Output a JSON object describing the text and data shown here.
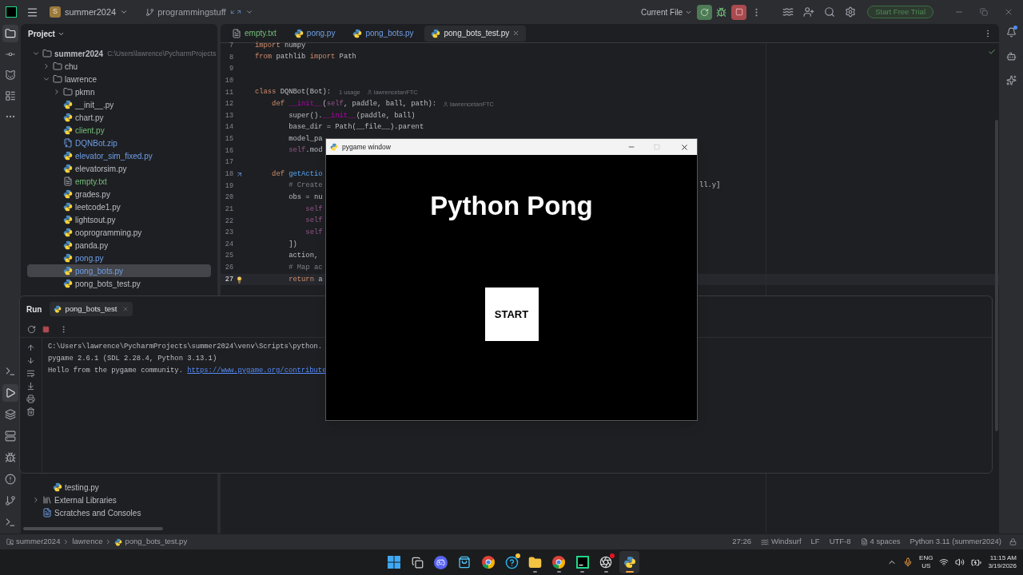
{
  "title_bar": {
    "project": {
      "badge": "S",
      "name": "summer2024"
    },
    "branch": "programmingstuff",
    "run_config": "Current File",
    "trial_button": "Start Free Trial"
  },
  "left_toolbar": {
    "top": [
      {
        "kind": "project",
        "selected": true
      },
      {
        "kind": "commit",
        "selected": false
      },
      {
        "kind": "pull_requests",
        "selected": false
      },
      {
        "kind": "structure",
        "selected": false
      },
      {
        "kind": "more",
        "selected": false
      }
    ],
    "bottom": [
      {
        "kind": "python_console",
        "selected": false
      },
      {
        "kind": "run",
        "selected": true
      },
      {
        "kind": "python_packages",
        "selected": false
      },
      {
        "kind": "services",
        "selected": false
      },
      {
        "kind": "debug",
        "selected": false
      },
      {
        "kind": "problems",
        "selected": false
      },
      {
        "kind": "git",
        "selected": false
      },
      {
        "kind": "terminal",
        "selected": false
      }
    ]
  },
  "right_toolbar": [
    {
      "kind": "notifications",
      "badge": true
    },
    {
      "kind": "ai_chat",
      "badge": false
    },
    {
      "kind": "windsurf",
      "badge": false
    }
  ],
  "project_panel": {
    "title": "Project",
    "tree": [
      {
        "label": "summer2024",
        "path": "C:\\Users\\lawrence\\PycharmProjects",
        "kind": "module",
        "added": false,
        "modified": false,
        "expanded": true,
        "selected": false,
        "children": [
          {
            "label": "chu",
            "kind": "folder",
            "added": false,
            "modified": false,
            "expanded": false,
            "selected": false
          },
          {
            "label": "lawrence",
            "kind": "folder",
            "added": false,
            "modified": false,
            "expanded": true,
            "selected": false,
            "children": [
              {
                "label": "pkmn",
                "kind": "plain_folder",
                "added": false,
                "modified": false,
                "expanded": false,
                "selected": false
              },
              {
                "label": "__init__.py",
                "kind": "python",
                "added": false,
                "modified": false,
                "selected": false
              },
              {
                "label": "chart.py",
                "kind": "python",
                "added": false,
                "modified": false,
                "selected": false
              },
              {
                "label": "client.py",
                "kind": "python",
                "added": true,
                "modified": false,
                "selected": false
              },
              {
                "label": "DQNBot.zip",
                "kind": "zip",
                "added": false,
                "modified": true,
                "selected": false
              },
              {
                "label": "elevator_sim_fixed.py",
                "kind": "python",
                "added": false,
                "modified": true,
                "selected": false
              },
              {
                "label": "elevatorsim.py",
                "kind": "python",
                "added": false,
                "modified": false,
                "selected": false
              },
              {
                "label": "empty.txt",
                "kind": "text",
                "added": true,
                "modified": false,
                "selected": false
              },
              {
                "label": "grades.py",
                "kind": "python",
                "added": false,
                "modified": false,
                "selected": false
              },
              {
                "label": "leetcode1.py",
                "kind": "python",
                "added": false,
                "modified": false,
                "selected": false
              },
              {
                "label": "lightsout.py",
                "kind": "python",
                "added": false,
                "modified": false,
                "selected": false
              },
              {
                "label": "ooprogramming.py",
                "kind": "python",
                "added": false,
                "modified": false,
                "selected": false
              },
              {
                "label": "panda.py",
                "kind": "python",
                "added": false,
                "modified": false,
                "selected": false
              },
              {
                "label": "pong.py",
                "kind": "python",
                "added": false,
                "modified": true,
                "selected": false
              },
              {
                "label": "pong_bots.py",
                "kind": "python",
                "added": false,
                "modified": true,
                "selected": true
              },
              {
                "label": "pong_bots_test.py",
                "kind": "python",
                "added": false,
                "modified": false,
                "selected": false
              }
            ]
          },
          {
            "label": "testing.py",
            "kind": "python",
            "added": false,
            "modified": false,
            "selected": false
          }
        ]
      },
      {
        "label": "External Libraries",
        "kind": "library",
        "added": false,
        "modified": false,
        "expanded": false,
        "selected": false
      },
      {
        "label": "Scratches and Consoles",
        "kind": "scratches",
        "added": false,
        "modified": false,
        "selected": false
      }
    ]
  },
  "editor": {
    "tabs": [
      {
        "label": "empty.txt",
        "kind": "text",
        "added": true,
        "modified": false,
        "selected": false
      },
      {
        "label": "pong.py",
        "kind": "python",
        "added": false,
        "modified": true,
        "selected": false
      },
      {
        "label": "pong_bots.py",
        "kind": "python",
        "added": false,
        "modified": true,
        "selected": false
      },
      {
        "label": "pong_bots_test.py",
        "kind": "python",
        "added": false,
        "modified": false,
        "selected": true
      }
    ],
    "lines": [
      {
        "number": "7",
        "kind": "code",
        "current": false,
        "segments": [
          {
            "kind": "keyword",
            "text": "import"
          },
          {
            "kind": "plain",
            "text": " numpy"
          }
        ]
      },
      {
        "number": "8",
        "kind": "code",
        "current": false,
        "segments": [
          {
            "kind": "keyword",
            "text": "from"
          },
          {
            "kind": "plain",
            "text": " pathlib "
          },
          {
            "kind": "keyword",
            "text": "import"
          },
          {
            "kind": "plain",
            "text": " Path"
          }
        ]
      },
      {
        "number": "9",
        "kind": "code",
        "current": false
      },
      {
        "number": "10",
        "kind": "code",
        "current": false
      },
      {
        "number": "11",
        "kind": "code",
        "current": false,
        "segments": [
          {
            "kind": "keyword",
            "text": "class"
          },
          {
            "kind": "plain",
            "text": " DQNBot(Bot):"
          }
        ],
        "usages": "1 usage",
        "author": "lawrencetanFTC"
      },
      {
        "number": "12",
        "kind": "code",
        "current": false,
        "segments": [
          {
            "kind": "keyword",
            "text": "    def "
          },
          {
            "kind": "magic",
            "text": "__init__"
          },
          {
            "kind": "plain",
            "text": "("
          },
          {
            "kind": "self",
            "text": "self"
          },
          {
            "kind": "plain",
            "text": ", paddle, ball, path):"
          }
        ],
        "author": "lawrencetanFTC"
      },
      {
        "number": "13",
        "kind": "code",
        "current": false,
        "segments": [
          {
            "kind": "plain",
            "text": "        super()."
          },
          {
            "kind": "magic",
            "text": "__init__"
          },
          {
            "kind": "plain",
            "text": "(paddle, ball)"
          }
        ]
      },
      {
        "number": "14",
        "kind": "code",
        "current": false,
        "segments": [
          {
            "kind": "plain",
            "text": "        base_dir = Path(__file__).parent"
          }
        ]
      },
      {
        "number": "15",
        "kind": "code",
        "current": false,
        "segments": [
          {
            "kind": "plain",
            "text": "        model_pa"
          }
        ]
      },
      {
        "number": "16",
        "kind": "code",
        "current": false,
        "segments": [
          {
            "kind": "self",
            "text": "        self"
          },
          {
            "kind": "plain",
            "text": ".mod"
          }
        ]
      },
      {
        "number": "17",
        "kind": "code",
        "current": false
      },
      {
        "number": "18",
        "kind": "override",
        "current": false,
        "segments": [
          {
            "kind": "keyword",
            "text": "    def "
          },
          {
            "kind": "function",
            "text": "getActio"
          }
        ]
      },
      {
        "number": "19",
        "kind": "code",
        "current": false,
        "segments": [
          {
            "kind": "comment",
            "text": "        # Create"
          }
        ],
        "trailing": "ll.y]"
      },
      {
        "number": "20",
        "kind": "code",
        "current": false,
        "segments": [
          {
            "kind": "plain",
            "text": "        obs = nu"
          }
        ]
      },
      {
        "number": "21",
        "kind": "code",
        "current": false,
        "segments": [
          {
            "kind": "self",
            "text": "            self"
          }
        ]
      },
      {
        "number": "22",
        "kind": "code",
        "current": false,
        "segments": [
          {
            "kind": "self",
            "text": "            self"
          }
        ]
      },
      {
        "number": "23",
        "kind": "code",
        "current": false,
        "segments": [
          {
            "kind": "self",
            "text": "            self"
          }
        ]
      },
      {
        "number": "24",
        "kind": "code",
        "current": false,
        "segments": [
          {
            "kind": "plain",
            "text": "        ])"
          }
        ]
      },
      {
        "number": "25",
        "kind": "code",
        "current": false,
        "segments": [
          {
            "kind": "plain",
            "text": "        action,"
          }
        ]
      },
      {
        "number": "26",
        "kind": "code",
        "current": false,
        "segments": [
          {
            "kind": "comment",
            "text": "        # Map ac"
          }
        ]
      },
      {
        "number": "27",
        "kind": "bulb",
        "current": true,
        "segments": [
          {
            "kind": "keyword",
            "text": "        return"
          },
          {
            "kind": "plain",
            "text": " a"
          }
        ]
      }
    ]
  },
  "run_panel": {
    "title": "Run",
    "tabs": [
      {
        "label": "pong_bots_test",
        "selected": true
      }
    ],
    "console": [
      {
        "text": "C:\\Users\\lawrence\\PycharmProjects\\summer2024\\venv\\Scripts\\python."
      },
      {
        "text": "pygame 2.6.1 (SDL 2.28.4, Python 3.13.1)"
      },
      {
        "text": "Hello from the pygame community. ",
        "link": "https://www.pygame.org/contribute"
      }
    ]
  },
  "pygame_window": {
    "title": "pygame window",
    "heading": "Python Pong",
    "button": "START"
  },
  "status_bar": {
    "breadcrumbs": [
      {
        "text": "summer2024",
        "kind": "module"
      },
      {
        "text": "lawrence",
        "kind": "folder"
      },
      {
        "text": "pong_bots_test.py",
        "kind": "python"
      }
    ],
    "items": [
      {
        "text": "27:26",
        "kind": "plain"
      },
      {
        "text": "Windsurf",
        "kind": "ai"
      },
      {
        "text": "LF",
        "kind": "plain"
      },
      {
        "text": "UTF-8",
        "kind": "plain"
      },
      {
        "text": "4 spaces",
        "kind": "indent"
      },
      {
        "text": "Python 3.11 (summer2024)",
        "kind": "plain"
      }
    ]
  },
  "taskbar": {
    "apps": [
      {
        "kind": "start",
        "running": false,
        "selected": false,
        "badge": false
      },
      {
        "kind": "task_view",
        "running": false,
        "selected": false,
        "badge": false
      },
      {
        "kind": "discord",
        "running": false,
        "selected": false,
        "badge": false
      },
      {
        "kind": "store",
        "running": false,
        "selected": false,
        "badge": false
      },
      {
        "kind": "chrome",
        "running": false,
        "selected": false,
        "badge": false
      },
      {
        "kind": "help",
        "running": false,
        "selected": false,
        "badge": true
      },
      {
        "kind": "explorer",
        "running": true,
        "selected": false,
        "badge": false
      },
      {
        "kind": "chrome",
        "running": true,
        "selected": false,
        "badge": false
      },
      {
        "kind": "pycharm",
        "running": true,
        "selected": false,
        "badge": false
      },
      {
        "kind": "obs",
        "running": true,
        "selected": false,
        "badge": true
      },
      {
        "kind": "python",
        "running": true,
        "selected": true,
        "badge": false
      }
    ],
    "tray": {
      "language": "ENG",
      "region": "US",
      "time": "11:15 AM",
      "date": "3/19/2026"
    }
  }
}
